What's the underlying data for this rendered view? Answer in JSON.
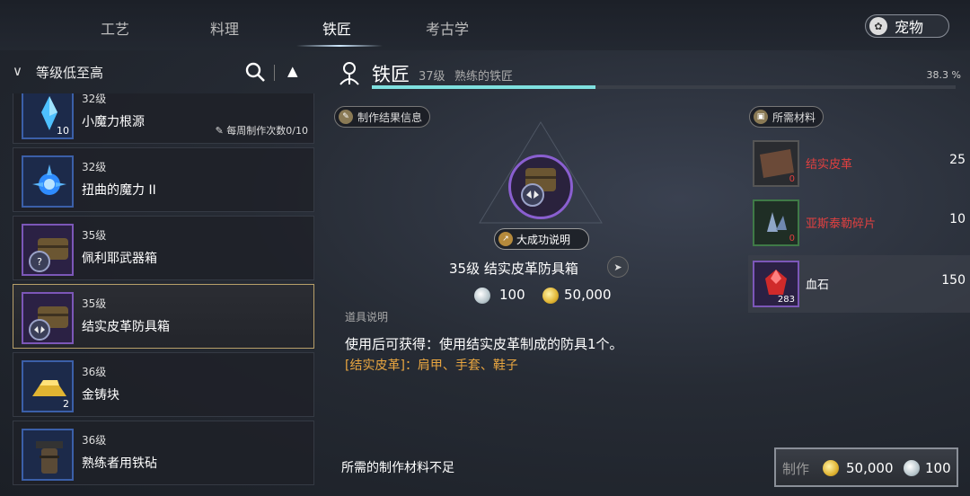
{
  "tabs": [
    {
      "label": "工艺",
      "active": false
    },
    {
      "label": "料理",
      "active": false
    },
    {
      "label": "铁匠",
      "active": true
    },
    {
      "label": "考古学",
      "active": false
    }
  ],
  "pet_button": {
    "label": "宠物",
    "icon": "paw-icon"
  },
  "sort": {
    "label": "等级低至高"
  },
  "items": [
    {
      "level": "32级",
      "name": "小魔力根源",
      "count": "10",
      "weekly": "每周制作次数0/10",
      "icon": "blue-crystal-icon",
      "frame": "blue"
    },
    {
      "level": "32级",
      "name": "扭曲的魔力 II",
      "count": "",
      "icon": "blue-energy-icon",
      "frame": "blue"
    },
    {
      "level": "35级",
      "name": "佩利耶武器箱",
      "count": "",
      "icon": "weapon-chest-icon",
      "frame": "purple"
    },
    {
      "level": "35级",
      "name": "结实皮革防具箱",
      "count": "",
      "icon": "armor-chest-icon",
      "frame": "purple",
      "selected": true
    },
    {
      "level": "36级",
      "name": "金铸块",
      "count": "2",
      "icon": "gold-ingot-icon",
      "frame": "blue"
    },
    {
      "level": "36级",
      "name": "熟练者用铁砧",
      "count": "",
      "icon": "anvil-icon",
      "frame": "blue"
    }
  ],
  "header": {
    "title": "铁匠",
    "level": "37级",
    "rank": "熟练的铁匠",
    "percent_label": "38.3 %",
    "progress": 0.383
  },
  "result": {
    "section_label": "制作结果信息",
    "success_button": "大成功说明",
    "name": "35级  结实皮革防具箱",
    "silver_cost": "100",
    "gold_cost": "50,000"
  },
  "description": {
    "heading": "道具说明",
    "line1": "使用后可获得：使用结实皮革制成的防具1个。",
    "line2_tag": "[结实皮革]",
    "line2_rest": "：肩甲、手套、鞋子"
  },
  "materials": {
    "section_label": "所需材料",
    "list": [
      {
        "name": "结实皮革",
        "have": "0",
        "need": "25",
        "color": "#e04040",
        "frame": "gray",
        "icon": "leather-icon"
      },
      {
        "name": "亚斯泰勒碎片",
        "have": "0",
        "need": "10",
        "color": "#e04040",
        "frame": "green",
        "icon": "crystal-shard-icon"
      },
      {
        "name": "血石",
        "have": "283",
        "need": "150",
        "color": "#ffffff",
        "frame": "purple",
        "icon": "bloodstone-icon"
      }
    ]
  },
  "footer": {
    "insufficient": "所需的制作材料不足",
    "craft_label": "制作",
    "craft_gold": "50,000",
    "craft_silver": "100"
  },
  "colors": {
    "accent": "#7fe0df",
    "selected_border": "#b8a06a",
    "warning": "#e04040",
    "highlight": "#e9a640"
  }
}
